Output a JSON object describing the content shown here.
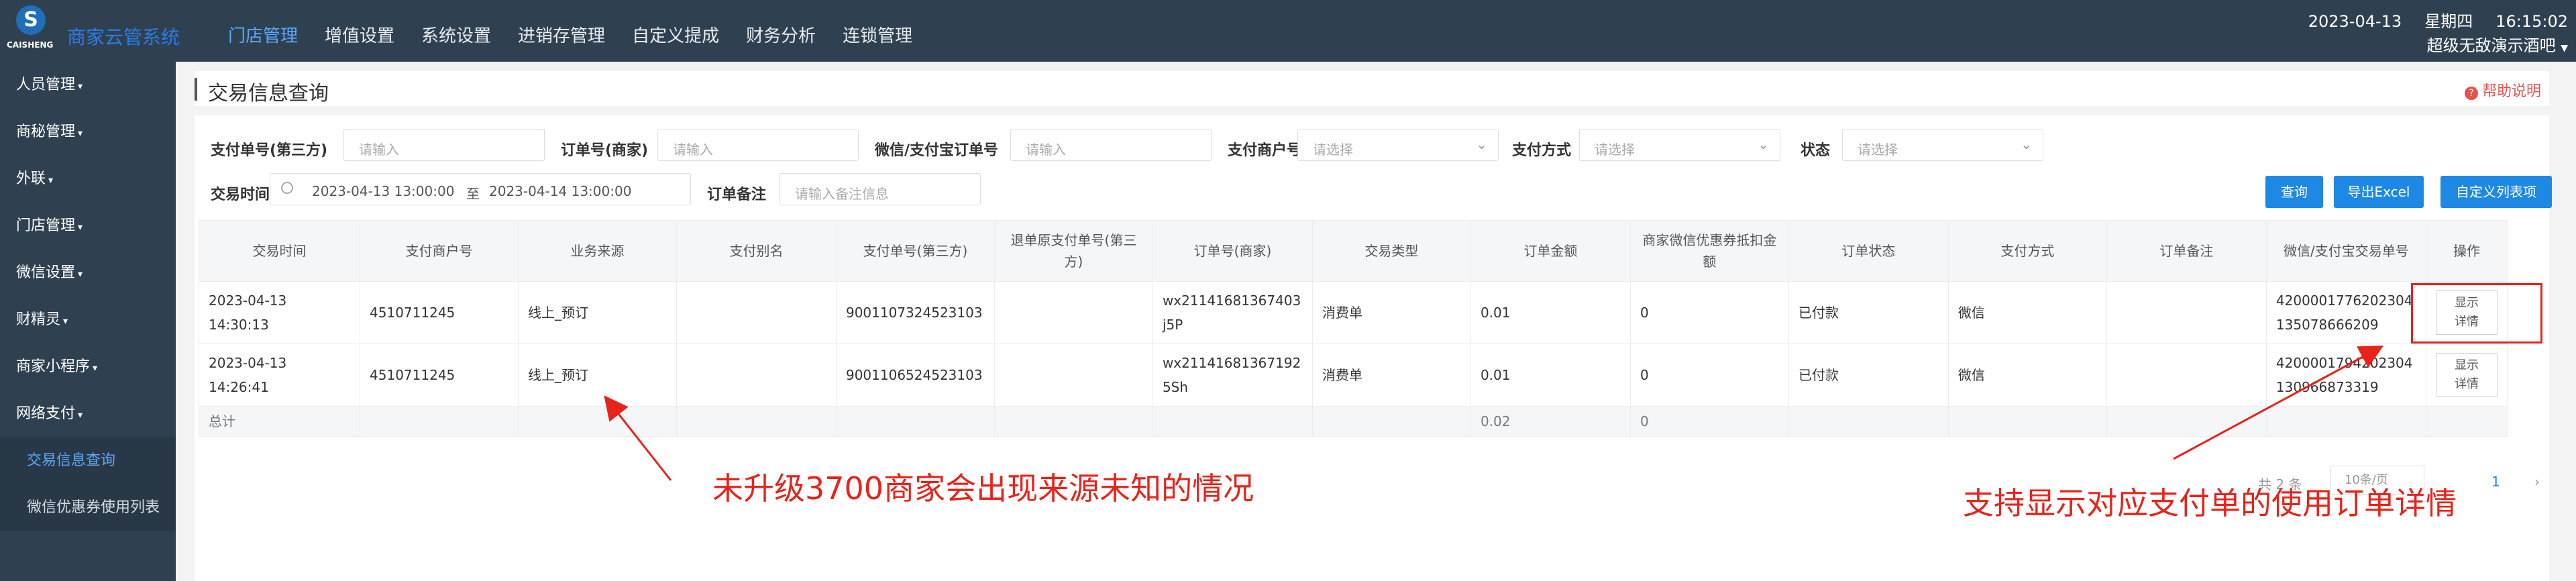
{
  "brand": {
    "logo_text": "CAISHENG",
    "system_name": "商家云管系统"
  },
  "topnav": [
    {
      "label": "门店管理",
      "active": true
    },
    {
      "label": "增值设置"
    },
    {
      "label": "系统设置"
    },
    {
      "label": "进销存管理"
    },
    {
      "label": "自定义提成"
    },
    {
      "label": "财务分析"
    },
    {
      "label": "连锁管理"
    }
  ],
  "topright": {
    "date": "2023-04-13",
    "weekday": "星期四",
    "time": "16:15:02",
    "store": "超级无敌演示酒吧"
  },
  "sidebar": {
    "items": [
      {
        "label": "人员管理"
      },
      {
        "label": "商秘管理"
      },
      {
        "label": "外联"
      },
      {
        "label": "门店管理"
      },
      {
        "label": "微信设置"
      },
      {
        "label": "财精灵"
      },
      {
        "label": "商家小程序"
      },
      {
        "label": "网络支付"
      }
    ],
    "subitems": [
      {
        "label": "交易信息查询",
        "active": true
      },
      {
        "label": "微信优惠券使用列表"
      }
    ]
  },
  "page": {
    "title": "交易信息查询",
    "help": "帮助说明"
  },
  "filters": {
    "pay_no_label": "支付单号(第三方)",
    "pay_no_ph": "请输入",
    "order_no_label": "订单号(商家)",
    "order_no_ph": "请输入",
    "wx_no_label": "微信/支付宝订单号",
    "wx_no_ph": "请输入",
    "merchant_label": "支付商户号",
    "merchant_ph": "请选择",
    "method_label": "支付方式",
    "method_ph": "请选择",
    "status_label": "状态",
    "status_ph": "请选择",
    "time_label": "交易时间",
    "time_start": "2023-04-13 13:00:00",
    "time_to": "至",
    "time_end": "2023-04-14 13:00:00",
    "remark_label": "订单备注",
    "remark_ph": "请输入备注信息"
  },
  "buttons": {
    "query": "查询",
    "export": "导出Excel",
    "custom": "自定义列表项"
  },
  "table": {
    "columns": [
      "交易时间",
      "支付商户号",
      "业务来源",
      "支付别名",
      "支付单号(第三方)",
      "退单原支付单号(第三方)",
      "订单号(商家)",
      "交易类型",
      "订单金额",
      "商家微信优惠券抵扣金额",
      "订单状态",
      "支付方式",
      "订单备注",
      "微信/支付宝交易单号",
      "操作"
    ],
    "rows": [
      [
        "2023-04-13 14:30:13",
        "4510711245",
        "线上_预订",
        "",
        "9001107324523103",
        "",
        "wx21141681367403j5P",
        "消费单",
        "0.01",
        "0",
        "已付款",
        "微信",
        "",
        "4200001776202304135078666209",
        "显示详情"
      ],
      [
        "2023-04-13 14:26:41",
        "4510711245",
        "线上_预订",
        "",
        "9001106524523103",
        "",
        "wx21141681367192 5Sh",
        "消费单",
        "0.01",
        "0",
        "已付款",
        "微信",
        "",
        "4200001794202304130966873319",
        "显示详情"
      ]
    ],
    "total_label": "总计",
    "total_amount": "0.02",
    "total_discount": "0"
  },
  "pager": {
    "total": "共 2 条",
    "size": "10条/页",
    "page": "1"
  },
  "annotations": {
    "left": "未升级3700商家会出现来源未知的情况",
    "right": "支持显示对应支付单的使用订单详情",
    "color": "#e8231a"
  }
}
